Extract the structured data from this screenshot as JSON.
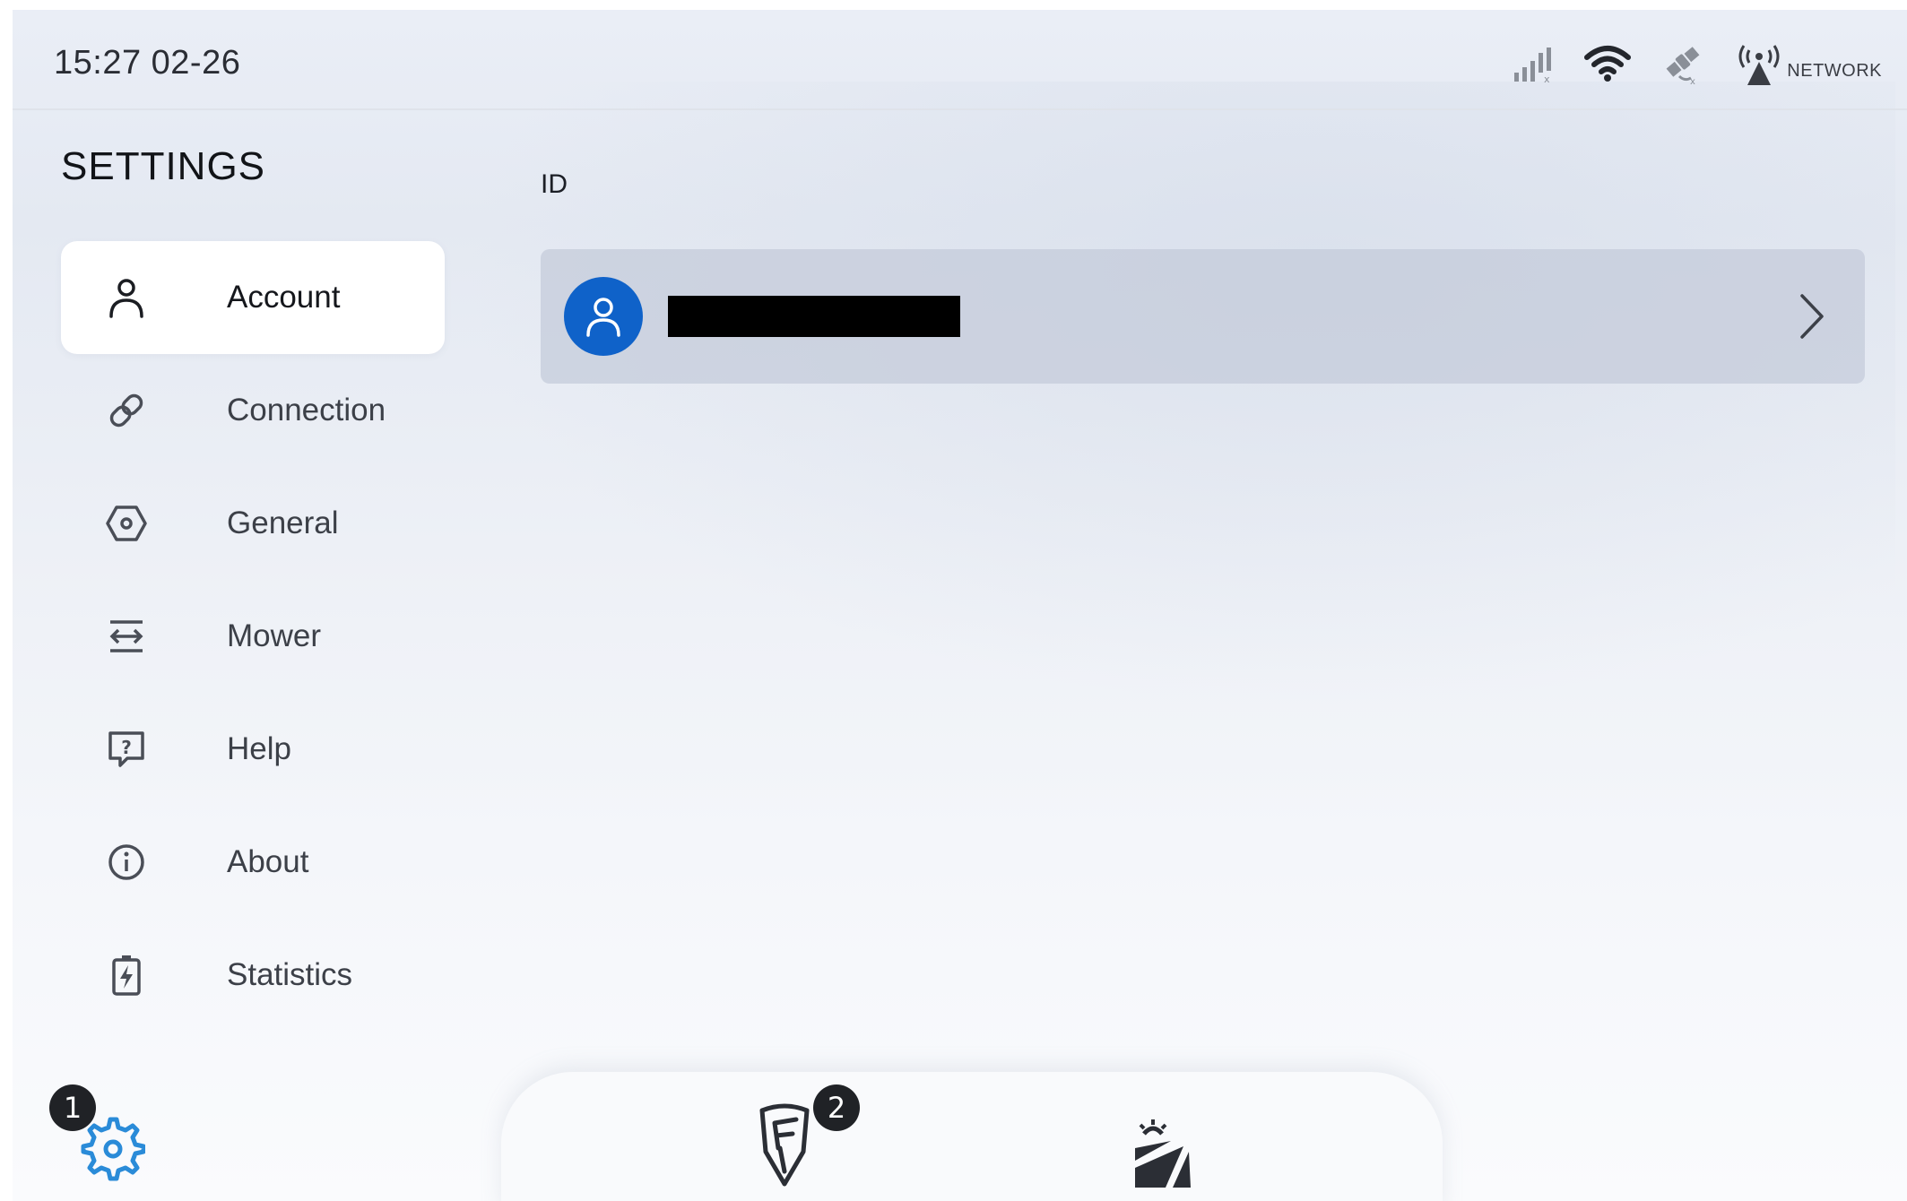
{
  "status_bar": {
    "time": "15:27 02-26",
    "icons": [
      "cellular-signal-icon",
      "wifi-icon",
      "satellite-icon",
      "network-antenna-icon"
    ],
    "network_label": "NETWORK"
  },
  "sidebar": {
    "title": "SETTINGS",
    "items": [
      {
        "label": "Account",
        "icon": "person-icon",
        "active": true
      },
      {
        "label": "Connection",
        "icon": "link-icon",
        "active": false
      },
      {
        "label": "General",
        "icon": "hexagon-settings-icon",
        "active": false
      },
      {
        "label": "Mower",
        "icon": "mower-arrows-icon",
        "active": false
      },
      {
        "label": "Help",
        "icon": "help-question-icon",
        "active": false
      },
      {
        "label": "About",
        "icon": "info-icon",
        "active": false
      },
      {
        "label": "Statistics",
        "icon": "battery-charge-icon",
        "active": false
      }
    ]
  },
  "content": {
    "section_title": "ID",
    "account_row": {
      "avatar_icon": "user-avatar-icon",
      "name_redacted": true,
      "chevron_icon": "chevron-right-icon"
    }
  },
  "bottom_bar": {
    "settings_icon": "gear-icon",
    "mower_icon": "mower-logo-icon",
    "field_icon": "field-sun-icon",
    "badges": [
      "1",
      "2"
    ]
  },
  "colors": {
    "accent": "#0f62c9",
    "gear_accent": "#2a8bd8",
    "badge": "#202226",
    "redaction": "#000000"
  }
}
